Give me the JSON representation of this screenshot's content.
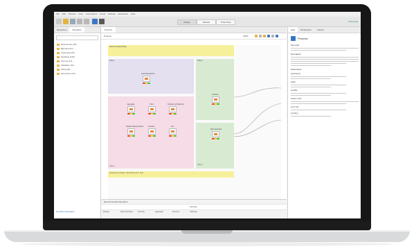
{
  "app": {
    "menu": [
      "File",
      "Edit",
      "Process",
      "View",
      "Connections",
      "Cloud",
      "Settings",
      "Extensions",
      "Help"
    ],
    "view_tabs": [
      "Design",
      "Results",
      "Turbo Prep",
      "Auto Model"
    ],
    "active_view": "Design",
    "user": "Username"
  },
  "left_panel": {
    "tabs": [
      "Repository",
      "Operators"
    ],
    "folders": [
      "Data Access (55)",
      "Blending (67)",
      "Cleansing (25)",
      "Modeling (169)",
      "Scoring (13)",
      "Validation (31)",
      "Utility (82)",
      "Extensions (23)"
    ],
    "footer_link": "Get More Operators"
  },
  "center": {
    "tab": "Process",
    "breadcrumb": "Process",
    "zoom": "100%",
    "annotations": {
      "top": "Recommended Setup",
      "step1": "Step 1",
      "step2": "Step 2",
      "step3": "Step 3",
      "step4": "Step 4",
      "bottom": "Example annotation: data flows left to right"
    },
    "nodes": [
      {
        "label": "Load Transactions",
        "caption": "out"
      },
      {
        "label": "Aggregate",
        "caption": "exa"
      },
      {
        "label": "Pivot",
        "caption": "exa"
      },
      {
        "label": "Rename by Replacing",
        "caption": "exa"
      },
      {
        "label": "Replace Missing Values",
        "caption": "exa"
      },
      {
        "label": "Rename",
        "caption": "exa"
      },
      {
        "label": "Join",
        "caption": "exa"
      },
      {
        "label": "Set Role",
        "caption": "exa"
      },
      {
        "label": "Filter Examples",
        "caption": "exa"
      }
    ],
    "repository": {
      "title": "Recommended Operators",
      "items": [
        "Multiply",
        "Filter Examples",
        "Set Role",
        "Aggregate",
        "Rename",
        "Generate Attributes"
      ]
    }
  },
  "right_panel": {
    "tabs": [
      "Help",
      "Parameters",
      "Context"
    ],
    "title": "Process",
    "sections": [
      "Synopsis",
      "Description",
      "Parameters"
    ],
    "params": [
      "logverbosity",
      "logfile",
      "resultfile",
      "random seed",
      "send mail",
      "encoding"
    ]
  },
  "colors": {
    "yellow_note": "#f7f09a",
    "purple_note": "#e4e0f0",
    "pink_note": "#f5dce6",
    "green_note": "#d9ead3",
    "accent_blue": "#2f78c4",
    "operator_orange": "#e58a3c"
  }
}
